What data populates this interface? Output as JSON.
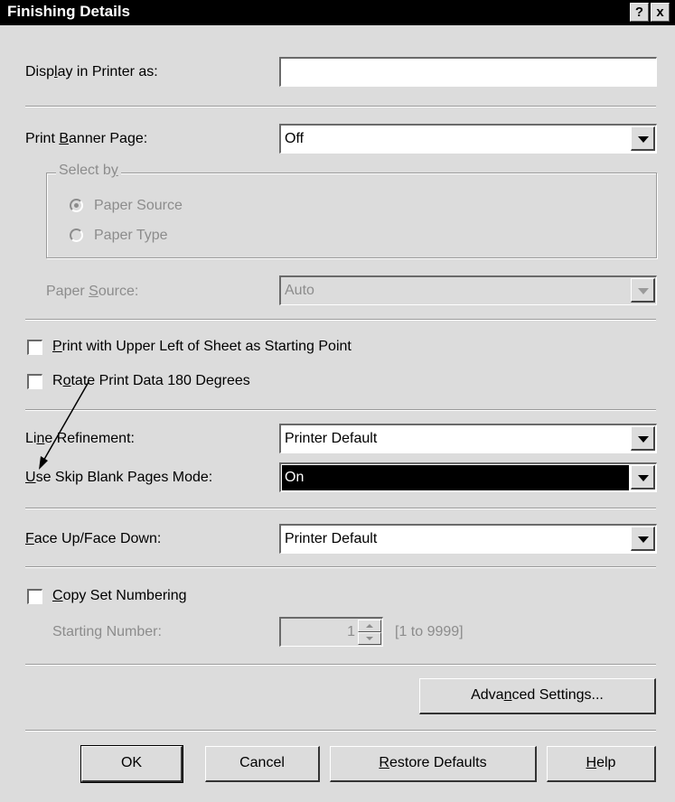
{
  "window": {
    "title": "Finishing Details",
    "help_glyph": "?",
    "close_glyph": "x"
  },
  "display_in_printer": {
    "label_pre": "Disp",
    "label_key": "l",
    "label_post": "ay in Printer as:",
    "value": ""
  },
  "banner": {
    "label_pre": "Print ",
    "label_key": "B",
    "label_post": "anner Page:",
    "value": "Off"
  },
  "select_by": {
    "label_pre": "Select b",
    "label_key": "y",
    "label_post": "",
    "options": [
      {
        "label": "Paper Source",
        "selected": true
      },
      {
        "label": "Paper Type",
        "selected": false
      }
    ]
  },
  "paper_source": {
    "label_pre": "Paper ",
    "label_key": "S",
    "label_post": "ource:",
    "value": "Auto"
  },
  "print_upper_left": {
    "label_pre": "",
    "label_key": "P",
    "label_post": "rint with Upper Left of Sheet as Starting Point",
    "checked": false
  },
  "rotate": {
    "label_pre": "R",
    "label_key": "o",
    "label_post": "tate Print Data 180 Degrees",
    "checked": false
  },
  "line_refinement": {
    "label_pre": "Li",
    "label_key": "n",
    "label_post": "e Refinement:",
    "value": "Printer Default"
  },
  "skip_blank": {
    "label_pre": "",
    "label_key": "U",
    "label_post": "se Skip Blank Pages Mode:",
    "value": "On"
  },
  "face_up": {
    "label_pre": "",
    "label_key": "F",
    "label_post": "ace Up/Face Down:",
    "value": "Printer Default"
  },
  "copy_set": {
    "label_pre": "",
    "label_key": "C",
    "label_post": "opy Set Numbering",
    "checked": false
  },
  "starting_number": {
    "label": "Starting Number:",
    "value": "1",
    "range": "[1 to 9999]"
  },
  "advanced": {
    "label_pre": "Adva",
    "label_key": "n",
    "label_post": "ced Settings..."
  },
  "buttons": {
    "ok": "OK",
    "cancel": "Cancel",
    "restore_key": "R",
    "restore_rest": "estore Defaults",
    "help_key": "H",
    "help_rest": "elp"
  },
  "colors": {
    "dialog_bg": "#dcdcdc",
    "titlebar_bg": "#000000",
    "selected_bg": "#000000",
    "disabled_text": "#8c8c8c"
  }
}
